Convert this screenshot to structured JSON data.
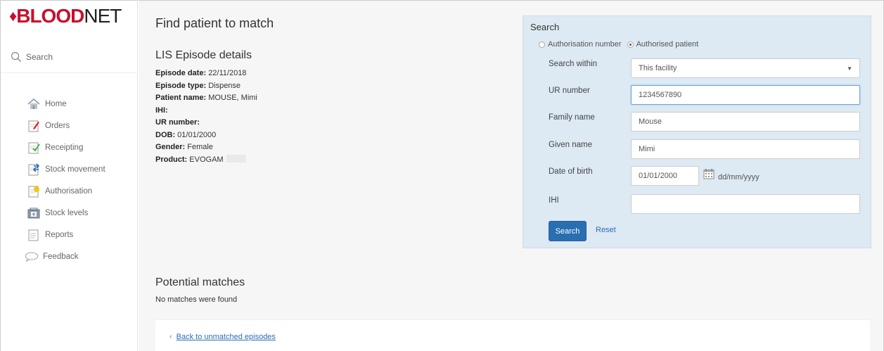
{
  "logo": {
    "drop": "♦",
    "blood": "BLOOD",
    "net": "NET"
  },
  "sidebar": {
    "search_label": "Search",
    "items": [
      {
        "label": "Home",
        "icon": "home-icon"
      },
      {
        "label": "Orders",
        "icon": "orders-icon"
      },
      {
        "label": "Receipting",
        "icon": "receipting-icon"
      },
      {
        "label": "Stock movement",
        "icon": "stock-movement-icon"
      },
      {
        "label": "Authorisation",
        "icon": "authorisation-icon"
      },
      {
        "label": "Stock levels",
        "icon": "stock-levels-icon"
      },
      {
        "label": "Reports",
        "icon": "reports-icon"
      },
      {
        "label": "Feedback",
        "icon": "feedback-icon"
      }
    ]
  },
  "page": {
    "title": "Find patient to match",
    "lis_title": "LIS Episode details"
  },
  "episode": {
    "date_label": "Episode date:",
    "date": "22/11/2018",
    "type_label": "Episode type:",
    "type": "Dispense",
    "patient_label": "Patient name:",
    "patient": "MOUSE, Mimi",
    "ihi_label": "IHI:",
    "ihi": "",
    "ur_label": "UR number:",
    "ur": "",
    "dob_label": "DOB:",
    "dob": "01/01/2000",
    "gender_label": "Gender:",
    "gender": "Female",
    "product_label": "Product:",
    "product": "EVOGAM"
  },
  "search": {
    "title": "Search",
    "radio_auth_number": "Authorisation number",
    "radio_auth_patient": "Authorised patient",
    "selected_radio": "Authorised patient",
    "search_within_label": "Search within",
    "search_within_value": "This facility",
    "ur_label": "UR number",
    "ur_value": "1234567890",
    "family_label": "Family name",
    "family_value": "Mouse",
    "given_label": "Given name",
    "given_value": "Mimi",
    "dob_label": "Date of birth",
    "dob_value": "01/01/2000",
    "dob_format": "dd/mm/yyyy",
    "ihi_label": "IHI",
    "ihi_value": "",
    "search_button": "Search",
    "reset_link": "Reset"
  },
  "matches": {
    "title": "Potential matches",
    "empty_text": "No matches were found",
    "back_link": "Back to unmatched episodes"
  },
  "colors": {
    "brand_red": "#c8102e",
    "primary_blue": "#2a6eb2",
    "panel_bg": "#dde9f3"
  }
}
